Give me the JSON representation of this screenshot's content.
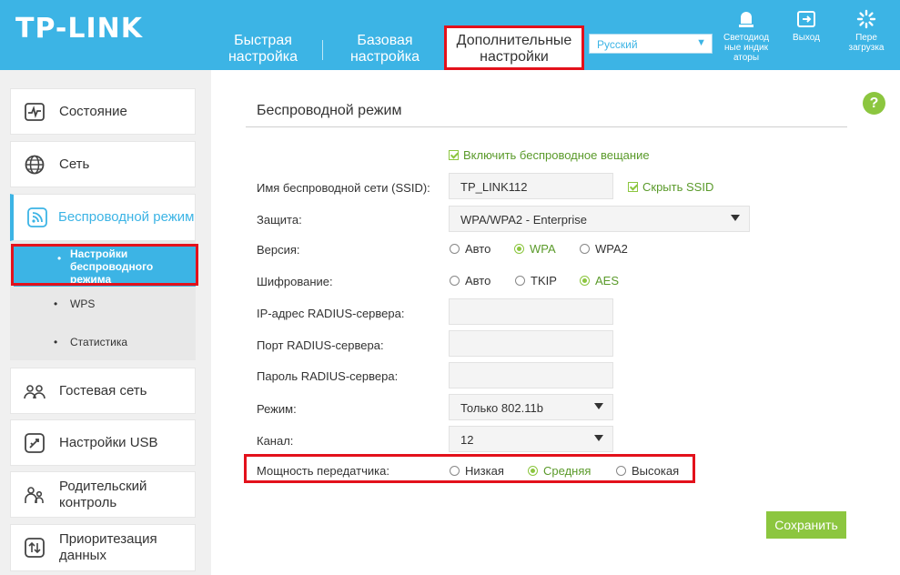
{
  "brand": {
    "logo": "TP-LINK"
  },
  "nav": {
    "tabs": [
      {
        "line1": "Быстрая",
        "line2": "настройка"
      },
      {
        "line1": "Базовая",
        "line2": "настройка"
      },
      {
        "line1": "Дополнительные",
        "line2": "настройки"
      }
    ],
    "language": "Русский",
    "icons": [
      {
        "icon": "led-icon",
        "label": "Светодиод ные индик аторы"
      },
      {
        "icon": "logout-icon",
        "label": "Выход"
      },
      {
        "icon": "reboot-icon",
        "label": "Пере загрузка"
      }
    ]
  },
  "sidebar": {
    "items": [
      {
        "icon": "status-icon",
        "label": "Состояние"
      },
      {
        "icon": "globe-icon",
        "label": "Сеть"
      },
      {
        "icon": "wireless-icon",
        "label": "Беспроводной режим"
      },
      {
        "icon": "guest-network-icon",
        "label": "Гостевая сеть"
      },
      {
        "icon": "usb-icon",
        "label": "Настройки USB"
      },
      {
        "icon": "parental-control-icon",
        "label": "Родительский контроль"
      },
      {
        "icon": "qos-icon",
        "label": "Приоритезация данных"
      }
    ],
    "sub_items": [
      {
        "label": "Настройки беспроводного режима"
      },
      {
        "label": "WPS"
      },
      {
        "label": "Статистика"
      }
    ]
  },
  "main": {
    "title": "Беспроводной режим",
    "enable_broadcast": "Включить беспроводное вещание",
    "ssid_label": "Имя беспроводной сети (SSID):",
    "ssid_value": "TP_LINK112",
    "hide_ssid": "Скрыть SSID",
    "security_label": "Защита:",
    "security_value": "WPA/WPA2 - Enterprise",
    "version_label": "Версия:",
    "version_options": [
      "Авто",
      "WPA",
      "WPA2"
    ],
    "encryption_label": "Шифрование:",
    "encryption_options": [
      "Авто",
      "TKIP",
      "AES"
    ],
    "radius_ip_label": "IP-адрес RADIUS-сервера:",
    "radius_port_label": "Порт RADIUS-сервера:",
    "radius_password_label": "Пароль RADIUS-сервера:",
    "mode_label": "Режим:",
    "mode_value": "Только 802.11b",
    "channel_label": "Канал:",
    "channel_value": "12",
    "tx_power_label": "Мощность передатчика:",
    "tx_power_options": [
      "Низкая",
      "Средняя",
      "Высокая"
    ],
    "save_label": "Сохранить",
    "help": "?"
  },
  "colors": {
    "accent": "#3cb4e5",
    "green": "#8cc63f",
    "highlight": "#e3111b"
  }
}
